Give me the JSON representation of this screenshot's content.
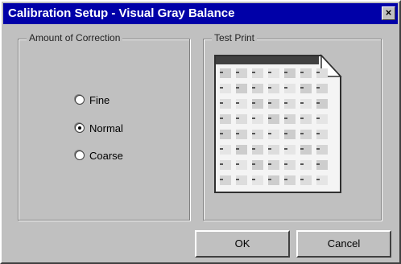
{
  "window": {
    "title": "Calibration Setup - Visual Gray Balance",
    "close_glyph": "×"
  },
  "correction_group": {
    "label": "Amount of Correction",
    "options": [
      {
        "label": "Fine",
        "checked": false
      },
      {
        "label": "Normal",
        "checked": true
      },
      {
        "label": "Coarse",
        "checked": false
      }
    ]
  },
  "test_print_group": {
    "label": "Test Print",
    "icon": "test-print-page-icon"
  },
  "buttons": {
    "ok_label": "OK",
    "cancel_label": "Cancel"
  }
}
